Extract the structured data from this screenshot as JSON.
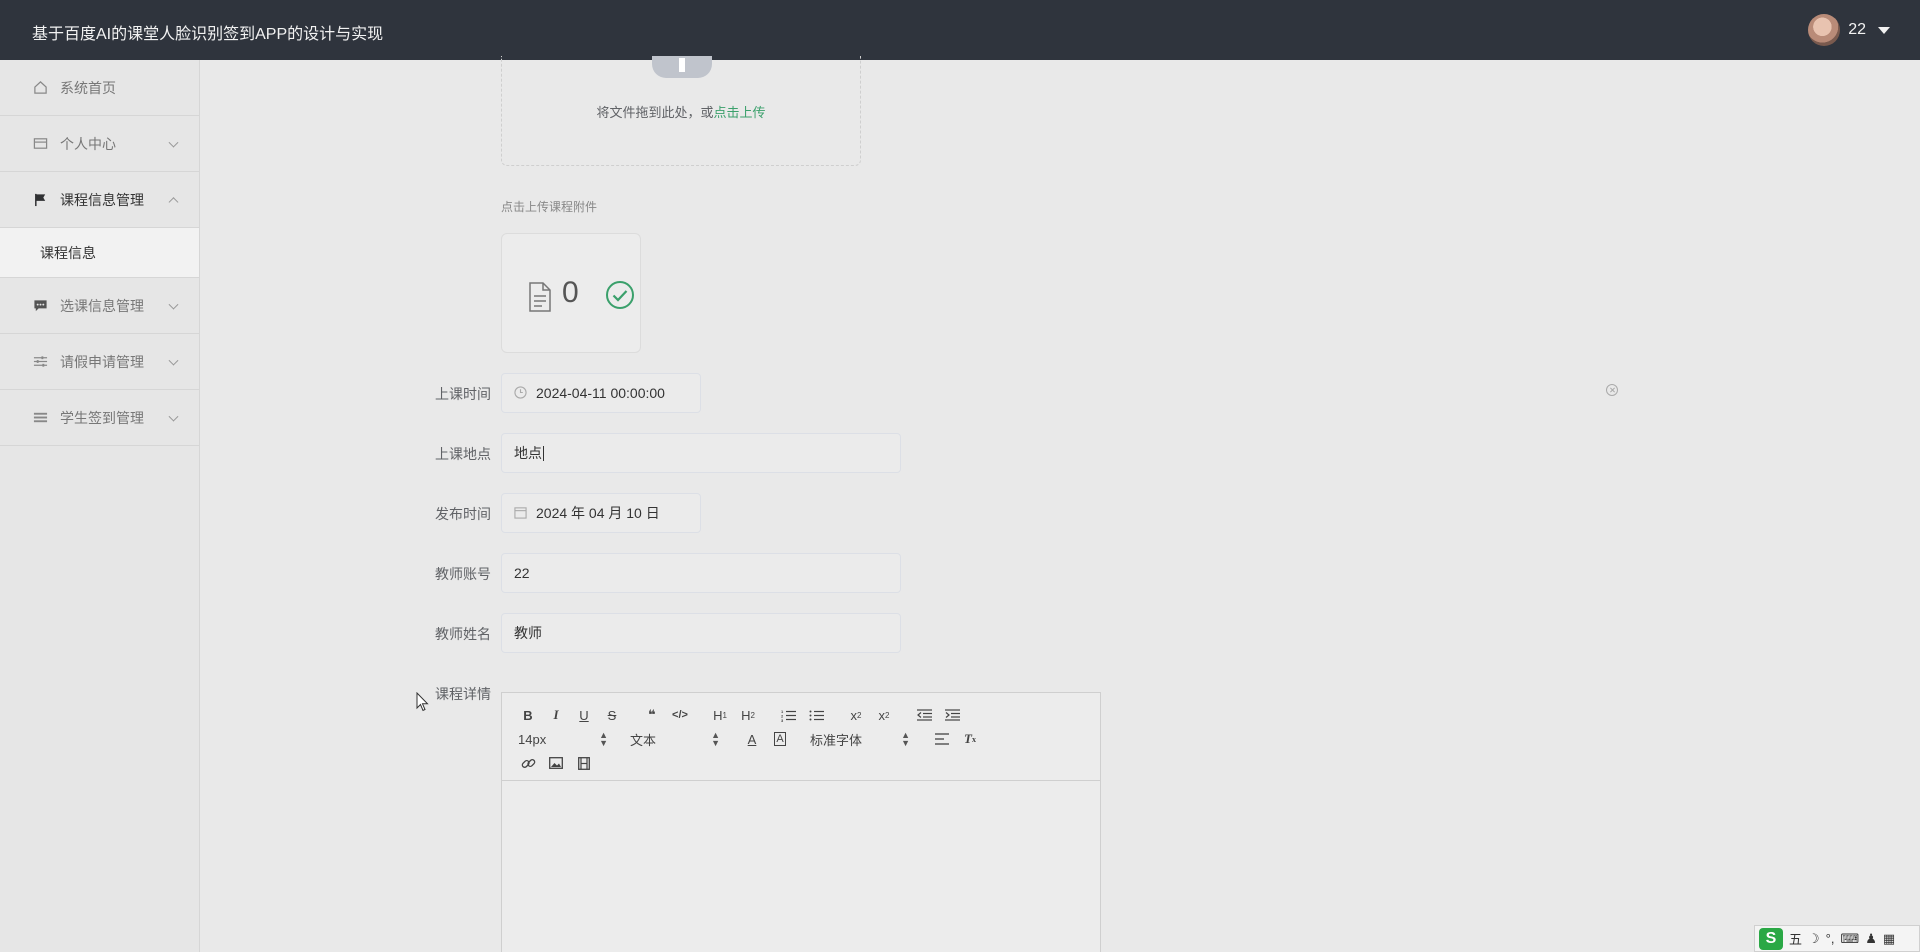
{
  "header": {
    "title": "基于百度AI的课堂人脸识别签到APP的设计与实现",
    "username": "22"
  },
  "sidebar": {
    "items": [
      {
        "label": "系统首页",
        "icon": "home-icon"
      },
      {
        "label": "个人中心",
        "icon": "card-icon"
      },
      {
        "label": "课程信息管理",
        "icon": "flag-icon"
      },
      {
        "label": "选课信息管理",
        "icon": "message-icon"
      },
      {
        "label": "请假申请管理",
        "icon": "sliders-icon"
      },
      {
        "label": "学生签到管理",
        "icon": "list-icon"
      }
    ],
    "sub_items": [
      {
        "label": "课程信息"
      }
    ]
  },
  "upload": {
    "text": "将文件拖到此处，或",
    "link": "点击上传",
    "tip": "点击上传课程附件",
    "file_count": "0"
  },
  "form": {
    "class_time_label": "上课时间",
    "class_time_value": "2024-04-11 00:00:00",
    "location_label": "上课地点",
    "location_value": "地点",
    "publish_time_label": "发布时间",
    "publish_time_value": "2024 年 04 月 10 日",
    "teacher_account_label": "教师账号",
    "teacher_account_value": "22",
    "teacher_name_label": "教师姓名",
    "teacher_name_value": "教师",
    "detail_label": "课程详情"
  },
  "editor": {
    "font_size": "14px",
    "block_type": "文本",
    "font_family": "标准字体"
  },
  "ime": {
    "mode": "五"
  },
  "colors": {
    "header_bg": "#2f343d",
    "link": "#3aa06b",
    "success": "#3aa06b"
  }
}
